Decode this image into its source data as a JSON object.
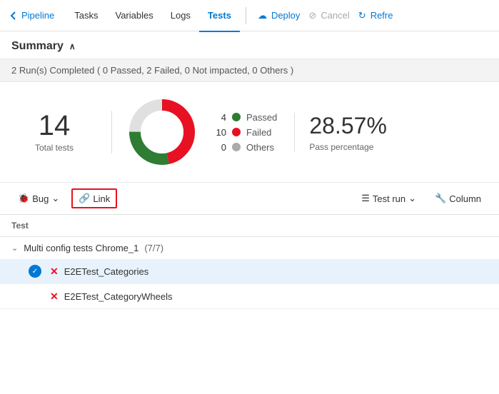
{
  "nav": {
    "back_label": "Pipeline",
    "items": [
      {
        "label": "Tasks",
        "active": false
      },
      {
        "label": "Variables",
        "active": false
      },
      {
        "label": "Logs",
        "active": false
      },
      {
        "label": "Tests",
        "active": true
      }
    ],
    "actions": [
      {
        "label": "Deploy",
        "icon": "cloud",
        "disabled": false
      },
      {
        "label": "Cancel",
        "icon": "cancel",
        "disabled": true
      },
      {
        "label": "Refre",
        "icon": "refresh",
        "disabled": false
      }
    ]
  },
  "summary": {
    "title": "Summary",
    "chevron": "∧"
  },
  "status_bar": {
    "text": "2 Run(s) Completed ( 0 Passed, 2 Failed, 0 Not impacted, 0 Others )"
  },
  "stats": {
    "total": "14",
    "total_label": "Total tests",
    "chart": {
      "passed": 4,
      "failed": 10,
      "others": 0
    },
    "legend": [
      {
        "count": "4",
        "label": "Passed",
        "color": "#2e7d32"
      },
      {
        "count": "10",
        "label": "Failed",
        "color": "#e81123"
      },
      {
        "count": "0",
        "label": "Others",
        "color": "#aaa"
      }
    ],
    "pass_pct": "28.57%",
    "pass_pct_label": "Pass percentage"
  },
  "toolbar": {
    "bug_label": "Bug",
    "link_label": "Link",
    "test_run_label": "Test run",
    "column_label": "Column"
  },
  "table": {
    "header": "Test",
    "group": {
      "label": "Multi config tests Chrome_1",
      "count": "(7/7)"
    },
    "rows": [
      {
        "name": "E2ETest_Categories",
        "selected": true,
        "failed": true
      },
      {
        "name": "E2ETest_CategoryWheels",
        "selected": false,
        "failed": true
      }
    ]
  }
}
